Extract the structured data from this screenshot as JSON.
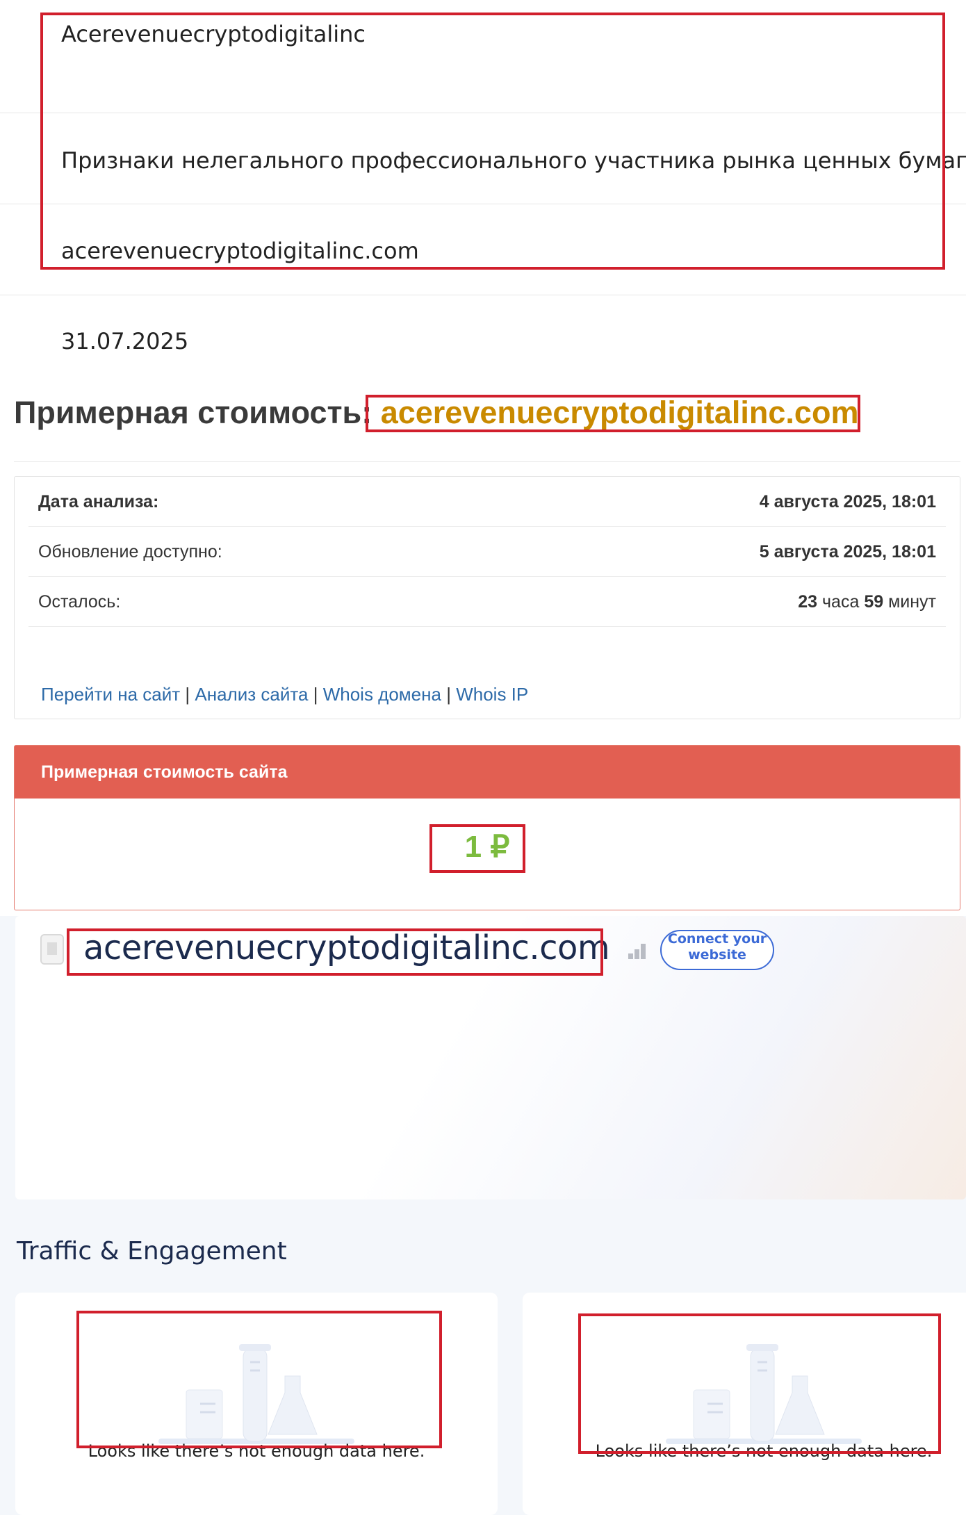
{
  "list": {
    "name": "Acerevenuecryptodigitalinc",
    "reason": "Признаки нелегального профессионального участника рынка ценных бумаг",
    "site": "acerevenuecryptodigitalinc.com",
    "date": "31.07.2025"
  },
  "valuation": {
    "title_prefix": "Примерная стоимость:",
    "domain": "acerevenuecryptodigitalinc.com",
    "rows": [
      {
        "label": "Дата анализа:",
        "value": "4 августа 2025, 18:01",
        "bold_label": true
      },
      {
        "label": "Обновление доступно:",
        "value": "5 августа 2025, 18:01",
        "bold_label": false
      },
      {
        "label": "Осталось:",
        "value_hours_num": "23",
        "value_hours_word": "часа",
        "value_min_num": "59",
        "value_min_word": "минут",
        "bold_label": false
      }
    ],
    "links": [
      "Перейти на сайт",
      "Анализ сайта",
      "Whois домена",
      "Whois IP"
    ],
    "separator": "|",
    "cost_panel_title": "Примерная стоимость сайта",
    "cost_value": "1 ₽",
    "colors": {
      "header_bg": "#e25f52",
      "cost": "#7cbb3e",
      "domain": "#c98a00",
      "link": "#2d6aa8"
    }
  },
  "similarweb": {
    "domain": "acerevenuecryptodigitalinc.com",
    "connect_button": "Connect your website",
    "section_title": "Traffic & Engagement",
    "empty_messages": [
      "Looks like there’s not enough data here.",
      "Looks like there’s not enough data here."
    ],
    "icons": [
      "favicon-placeholder-icon",
      "signal-bars-icon",
      "empty-data-illustration"
    ]
  },
  "highlight_color": "#d11f2c"
}
